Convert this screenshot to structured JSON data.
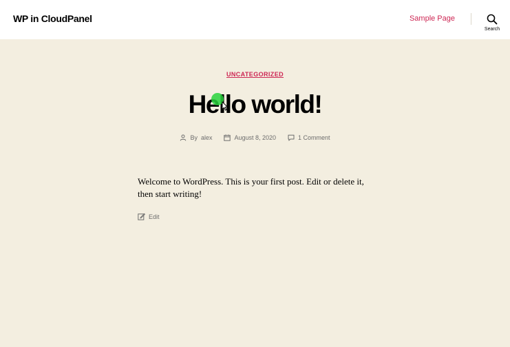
{
  "header": {
    "site_title": "WP in CloudPanel",
    "nav": [
      {
        "label": "Sample Page"
      }
    ],
    "search_label": "Search"
  },
  "post": {
    "category": "UNCATEGORIZED",
    "title": "Hello world!",
    "meta": {
      "author_prefix": "By",
      "author": "alex",
      "date": "August 8, 2020",
      "comments": "1 Comment"
    },
    "content": "Welcome to WordPress. This is your first post. Edit or delete it, then start writing!",
    "edit_label": "Edit"
  },
  "colors": {
    "accent": "#cd2653",
    "background": "#f3eee0",
    "header_bg": "#ffffff",
    "meta_text": "#6d6d6d"
  }
}
